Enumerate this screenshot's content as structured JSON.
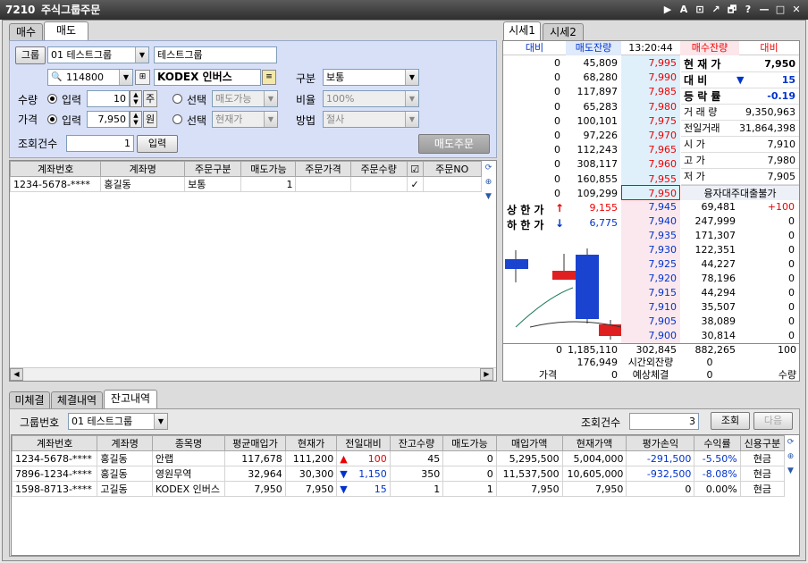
{
  "window": {
    "num": "7210",
    "title": "주식그룹주문",
    "buttons": [
      "▶",
      "A",
      "⊡",
      "↗",
      "🗗",
      "?",
      "—",
      "□",
      "✕"
    ]
  },
  "order": {
    "tabs": [
      "매수",
      "매도"
    ],
    "group_btn": "그룹",
    "group_sel": "01 테스트그룹",
    "group_name": "테스트그룹",
    "code": "114800",
    "stock_name": "KODEX 인버스",
    "gubun_lbl": "구분",
    "gubun_val": "보통",
    "qty_lbl": "수량",
    "price_lbl": "가격",
    "input_lbl": "입력",
    "select_lbl": "선택",
    "qty": "10",
    "qty_unit": "주",
    "price": "7,950",
    "price_unit": "원",
    "qty_sel": "매도가능",
    "price_sel": "현재가",
    "ratio_lbl": "비율",
    "ratio_val": "100%",
    "method_lbl": "방법",
    "method_val": "절사",
    "count_lbl": "조회건수",
    "count_val": "1",
    "input_btn": "입력",
    "sell_btn": "매도주문"
  },
  "acct": {
    "headers": [
      "계좌번호",
      "계좌명",
      "주문구분",
      "매도가능",
      "주문가격",
      "주문수량",
      "☑",
      "주문NO"
    ],
    "rows": [
      {
        "acct": "1234-5678-****",
        "name": "홍길동",
        "type": "보통",
        "avail": "1",
        "price": "",
        "qty": "",
        "chk": "✓",
        "no": ""
      }
    ]
  },
  "quote": {
    "tabs": [
      "시세1",
      "시세2"
    ],
    "header": {
      "a": "대비",
      "b": "매도잔량",
      "time": "13:20:44",
      "c": "매수잔량",
      "d": "대비"
    },
    "asks": [
      {
        "chg": "0",
        "qty": "45,809",
        "price": "7,995"
      },
      {
        "chg": "0",
        "qty": "68,280",
        "price": "7,990"
      },
      {
        "chg": "0",
        "qty": "117,897",
        "price": "7,985"
      },
      {
        "chg": "0",
        "qty": "65,283",
        "price": "7,980"
      },
      {
        "chg": "0",
        "qty": "100,101",
        "price": "7,975"
      },
      {
        "chg": "0",
        "qty": "97,226",
        "price": "7,970"
      },
      {
        "chg": "0",
        "qty": "112,243",
        "price": "7,965"
      },
      {
        "chg": "0",
        "qty": "308,117",
        "price": "7,960"
      },
      {
        "chg": "0",
        "qty": "160,855",
        "price": "7,955"
      },
      {
        "chg": "0",
        "qty": "109,299",
        "price": "7,950"
      }
    ],
    "info": [
      {
        "k": "현 재 가",
        "v": "7,950"
      },
      {
        "k": "대    비",
        "v": "15",
        "arrow": "▼"
      },
      {
        "k": "등 락 률",
        "v": "-0.19"
      },
      {
        "k": "거 래 량",
        "v": "9,350,963"
      },
      {
        "k": "전일거래",
        "v": "31,864,398"
      },
      {
        "k": "시    가",
        "v": "7,910"
      },
      {
        "k": "고    가",
        "v": "7,980"
      },
      {
        "k": "저    가",
        "v": "7,905"
      }
    ],
    "loan_lbl": "융자대주대출불가",
    "upper_lbl": "상 한 가",
    "upper_val": "9,155",
    "lower_lbl": "하 한 가",
    "lower_val": "6,775",
    "bids": [
      {
        "price": "7,945",
        "qty": "69,481",
        "chg": "+100"
      },
      {
        "price": "7,940",
        "qty": "247,999",
        "chg": "0"
      },
      {
        "price": "7,935",
        "qty": "171,307",
        "chg": "0"
      },
      {
        "price": "7,930",
        "qty": "122,351",
        "chg": "0"
      },
      {
        "price": "7,925",
        "qty": "44,227",
        "chg": "0"
      },
      {
        "price": "7,920",
        "qty": "78,196",
        "chg": "0"
      },
      {
        "price": "7,915",
        "qty": "44,294",
        "chg": "0"
      },
      {
        "price": "7,910",
        "qty": "35,507",
        "chg": "0"
      },
      {
        "price": "7,905",
        "qty": "38,089",
        "chg": "0"
      },
      {
        "price": "7,900",
        "qty": "30,814",
        "chg": "0"
      }
    ],
    "foot1": [
      "0",
      "1,185,110",
      "302,845",
      "882,265",
      "100"
    ],
    "foot2": [
      "176,949",
      "시간외잔량",
      "0"
    ],
    "foot3": [
      "가격",
      "0",
      "예상체결",
      "0",
      "수량"
    ]
  },
  "bottom": {
    "tabs": [
      "미체결",
      "체결내역",
      "잔고내역"
    ],
    "group_lbl": "그룹번호",
    "group_sel": "01 테스트그룹",
    "count_lbl": "조회건수",
    "count_val": "3",
    "query_btn": "조회",
    "next_btn": "다음",
    "headers": [
      "계좌번호",
      "계좌명",
      "종목명",
      "평균매입가",
      "현재가",
      "전일대비",
      "잔고수량",
      "매도가능",
      "매입가액",
      "현재가액",
      "평가손익",
      "수익률",
      "신용구분"
    ],
    "rows": [
      {
        "acct": "1234-5678-****",
        "name": "홍길동",
        "stock": "안랩",
        "avg": "117,678",
        "cur": "111,200",
        "arrow": "▲",
        "diff": "100",
        "bal": "45",
        "avail": "0",
        "buy": "5,295,500",
        "curamt": "5,004,000",
        "pl": "-291,500",
        "rate": "-5.50%",
        "credit": "현금"
      },
      {
        "acct": "7896-1234-****",
        "name": "홍길동",
        "stock": "영원무역",
        "avg": "32,964",
        "cur": "30,300",
        "arrow": "▼",
        "diff": "1,150",
        "bal": "350",
        "avail": "0",
        "buy": "11,537,500",
        "curamt": "10,605,000",
        "pl": "-932,500",
        "rate": "-8.08%",
        "credit": "현금"
      },
      {
        "acct": "1598-8713-****",
        "name": "고길동",
        "stock": "KODEX 인버스",
        "avg": "7,950",
        "cur": "7,950",
        "arrow": "▼",
        "diff": "15",
        "bal": "1",
        "avail": "1",
        "buy": "7,950",
        "curamt": "7,950",
        "pl": "0",
        "rate": "0.00%",
        "credit": "현금"
      }
    ]
  }
}
